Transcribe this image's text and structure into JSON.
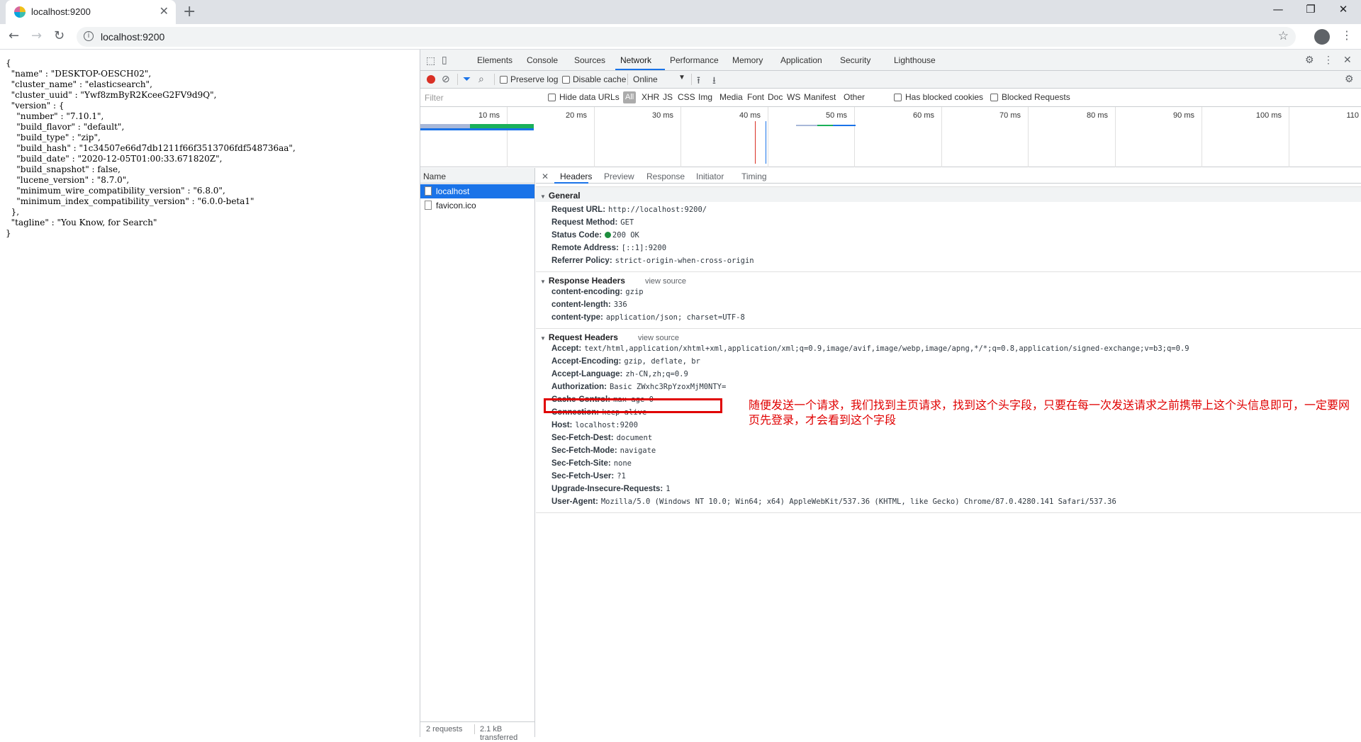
{
  "browser": {
    "tab_title": "localhost:9200",
    "url": "localhost:9200",
    "window_controls": {
      "minimize": "—",
      "maximize": "❐",
      "close": "✕"
    }
  },
  "page": {
    "json_text": "{\n  \"name\" : \"DESKTOP-OESCH02\",\n  \"cluster_name\" : \"elasticsearch\",\n  \"cluster_uuid\" : \"Ywf8zmByR2KceeG2FV9d9Q\",\n  \"version\" : {\n    \"number\" : \"7.10.1\",\n    \"build_flavor\" : \"default\",\n    \"build_type\" : \"zip\",\n    \"build_hash\" : \"1c34507e66d7db1211f66f3513706fdf548736aa\",\n    \"build_date\" : \"2020-12-05T01:00:33.671820Z\",\n    \"build_snapshot\" : false,\n    \"lucene_version\" : \"8.7.0\",\n    \"minimum_wire_compatibility_version\" : \"6.8.0\",\n    \"minimum_index_compatibility_version\" : \"6.0.0-beta1\"\n  },\n  \"tagline\" : \"You Know, for Search\"\n}"
  },
  "devtools": {
    "tabs": [
      "Elements",
      "Console",
      "Sources",
      "Network",
      "Performance",
      "Memory",
      "Application",
      "Security",
      "Lighthouse"
    ],
    "active_tab": "Network",
    "net_toolbar": {
      "preserve_log": "Preserve log",
      "disable_cache": "Disable cache",
      "throttling": "Online"
    },
    "filter": {
      "placeholder": "Filter",
      "hide_data_urls": "Hide data URLs",
      "types": [
        "All",
        "XHR",
        "JS",
        "CSS",
        "Img",
        "Media",
        "Font",
        "Doc",
        "WS",
        "Manifest",
        "Other"
      ],
      "has_blocked_cookies": "Has blocked cookies",
      "blocked_requests": "Blocked Requests"
    },
    "timeline_ticks": [
      "10 ms",
      "20 ms",
      "30 ms",
      "40 ms",
      "50 ms",
      "60 ms",
      "70 ms",
      "80 ms",
      "90 ms",
      "100 ms",
      "110"
    ],
    "request_list": {
      "header": "Name",
      "rows": [
        "localhost",
        "favicon.ico"
      ],
      "summary_requests": "2 requests",
      "summary_transferred": "2.1 kB transferred"
    },
    "detail_tabs": [
      "Headers",
      "Preview",
      "Response",
      "Initiator",
      "Timing"
    ],
    "general": {
      "title": "General",
      "items": [
        {
          "k": "Request URL:",
          "v": "http://localhost:9200/"
        },
        {
          "k": "Request Method:",
          "v": "GET"
        },
        {
          "k": "Status Code:",
          "v": "200 OK"
        },
        {
          "k": "Remote Address:",
          "v": "[::1]:9200"
        },
        {
          "k": "Referrer Policy:",
          "v": "strict-origin-when-cross-origin"
        }
      ]
    },
    "response_headers": {
      "title": "Response Headers",
      "view_source": "view source",
      "items": [
        {
          "k": "content-encoding:",
          "v": "gzip"
        },
        {
          "k": "content-length:",
          "v": "336"
        },
        {
          "k": "content-type:",
          "v": "application/json; charset=UTF-8"
        }
      ]
    },
    "request_headers": {
      "title": "Request Headers",
      "view_source": "view source",
      "items": [
        {
          "k": "Accept:",
          "v": "text/html,application/xhtml+xml,application/xml;q=0.9,image/avif,image/webp,image/apng,*/*;q=0.8,application/signed-exchange;v=b3;q=0.9"
        },
        {
          "k": "Accept-Encoding:",
          "v": "gzip, deflate, br"
        },
        {
          "k": "Accept-Language:",
          "v": "zh-CN,zh;q=0.9"
        },
        {
          "k": "Authorization:",
          "v": "Basic ZWxhc3RpYzoxMjM0NTY="
        },
        {
          "k": "Cache-Control:",
          "v": "max-age=0"
        },
        {
          "k": "Connection:",
          "v": "keep-alive"
        },
        {
          "k": "Host:",
          "v": "localhost:9200"
        },
        {
          "k": "Sec-Fetch-Dest:",
          "v": "document"
        },
        {
          "k": "Sec-Fetch-Mode:",
          "v": "navigate"
        },
        {
          "k": "Sec-Fetch-Site:",
          "v": "none"
        },
        {
          "k": "Sec-Fetch-User:",
          "v": "?1"
        },
        {
          "k": "Upgrade-Insecure-Requests:",
          "v": "1"
        },
        {
          "k": "User-Agent:",
          "v": "Mozilla/5.0 (Windows NT 10.0; Win64; x64) AppleWebKit/537.36 (KHTML, like Gecko) Chrome/87.0.4280.141 Safari/537.36"
        }
      ]
    }
  },
  "annotation": "随便发送一个请求，我们找到主页请求，找到这个头字段，只要在每一次发送请求之前携带上这个头信息即可，一定要网页先登录，才会看到这个字段",
  "colors": {
    "accent": "#1a73e8",
    "annotation_red": "#e00000",
    "record_red": "#d93025",
    "status_green": "#1e8e3e"
  }
}
